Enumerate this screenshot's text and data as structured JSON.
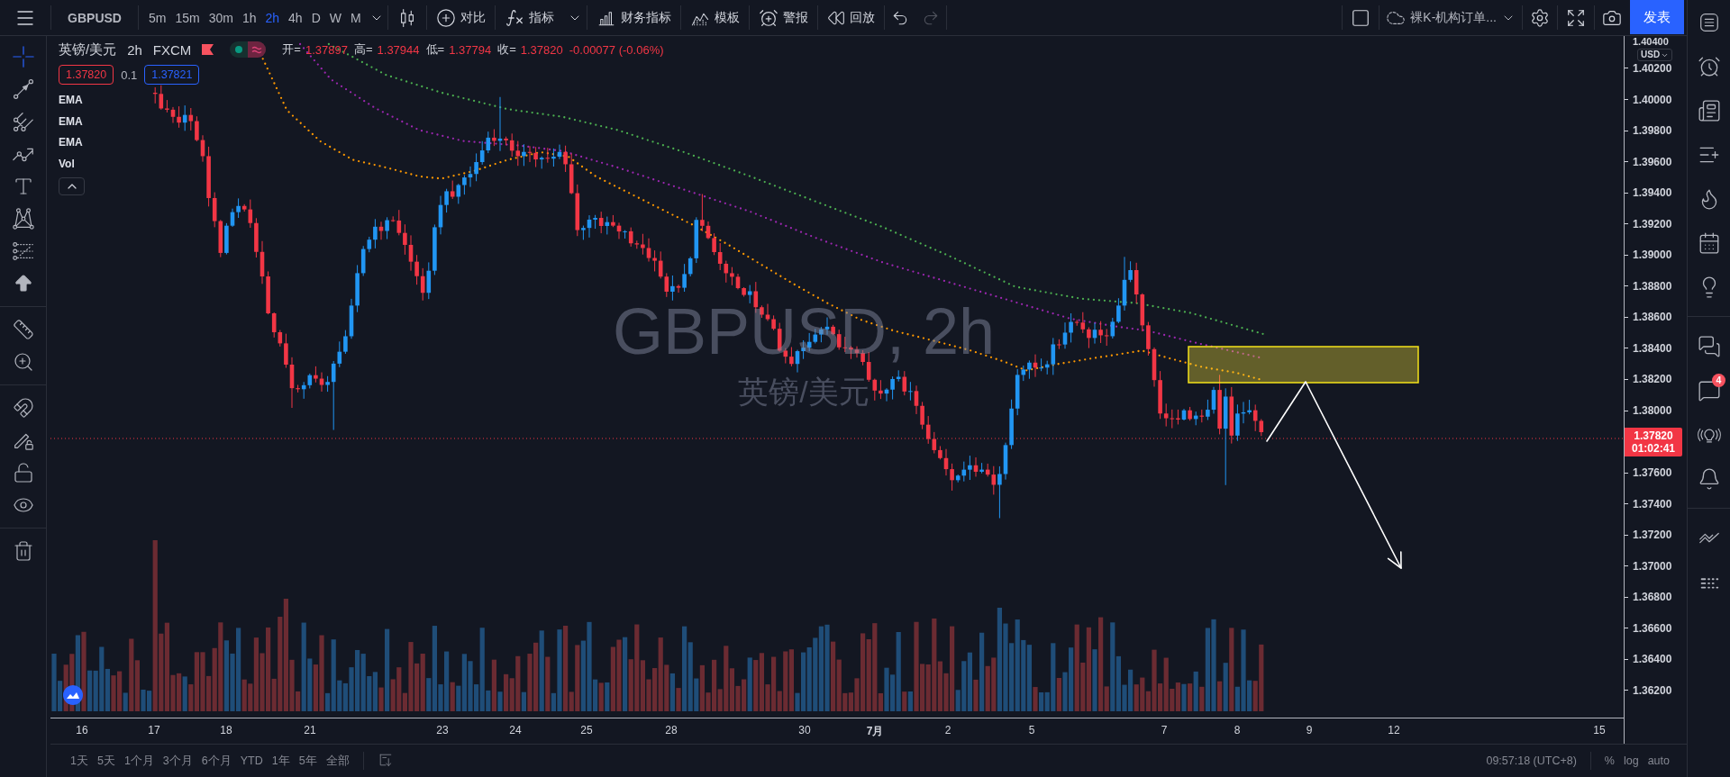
{
  "top_toolbar": {
    "symbol": "GBPUSD",
    "intervals": [
      {
        "label": "5m",
        "selected": false
      },
      {
        "label": "15m",
        "selected": false
      },
      {
        "label": "30m",
        "selected": false
      },
      {
        "label": "1h",
        "selected": false
      },
      {
        "label": "2h",
        "selected": true
      },
      {
        "label": "4h",
        "selected": false
      },
      {
        "label": "D",
        "selected": false
      },
      {
        "label": "W",
        "selected": false
      },
      {
        "label": "M",
        "selected": false
      }
    ],
    "actions": [
      {
        "kind": "compare",
        "label": "对比"
      },
      {
        "kind": "indicators",
        "label": "指标"
      },
      {
        "kind": "financials",
        "label": "财务指标"
      },
      {
        "kind": "templates",
        "label": "模板"
      },
      {
        "kind": "alert",
        "label": "警报"
      },
      {
        "kind": "replay",
        "label": "回放"
      }
    ],
    "undo": {
      "disabled": false
    },
    "redo": {
      "disabled": true
    },
    "layout_name": "裸K-机构订单...",
    "publish": "发表"
  },
  "left_toolbar": {
    "groups": [
      [
        {
          "kind": "crosshair",
          "selected": true
        },
        {
          "kind": "trend-line",
          "selected": false
        },
        {
          "kind": "pitchfork",
          "selected": false
        },
        {
          "kind": "path",
          "selected": false
        },
        {
          "kind": "text",
          "selected": false
        },
        {
          "kind": "pattern",
          "selected": false
        },
        {
          "kind": "fib",
          "selected": false
        },
        {
          "kind": "arrow",
          "selected": false
        }
      ],
      [
        {
          "kind": "ruler",
          "selected": false
        },
        {
          "kind": "zoom",
          "selected": false
        }
      ],
      [
        {
          "kind": "magnet",
          "selected": false
        },
        {
          "kind": "draw-lock",
          "selected": false
        },
        {
          "kind": "lock",
          "selected": false
        },
        {
          "kind": "eye",
          "selected": false
        }
      ],
      [
        {
          "kind": "trash",
          "selected": false
        }
      ]
    ]
  },
  "legend": {
    "name": "英镑/美元",
    "interval": "2h",
    "source": "FXCM",
    "ohlc": [
      {
        "label": "开=",
        "value": "1.37897"
      },
      {
        "label": "高=",
        "value": "1.37944"
      },
      {
        "label": "低=",
        "value": "1.37794"
      },
      {
        "label": "收=",
        "value": "1.37820"
      }
    ],
    "change": "-0.00077 (-0.06%)",
    "sell": "1.37820",
    "spread": "0.1",
    "buy": "1.37821",
    "studies": [
      "EMA",
      "EMA",
      "EMA",
      "Vol"
    ]
  },
  "chart": {
    "watermark_title": "GBPUSD, 2h",
    "watermark_subtitle": "英镑/美元"
  },
  "price_axis": {
    "top_label": "1.40400",
    "currency": "USD",
    "ticks": [
      {
        "kind": "tick",
        "label": "1.40200"
      },
      {
        "kind": "tick",
        "label": "1.40000"
      },
      {
        "kind": "tick",
        "label": "1.39800"
      },
      {
        "kind": "tick",
        "label": "1.39600"
      },
      {
        "kind": "tick",
        "label": "1.39400"
      },
      {
        "kind": "tick",
        "label": "1.39200"
      },
      {
        "kind": "tick",
        "label": "1.39000"
      },
      {
        "kind": "tick",
        "label": "1.38800"
      },
      {
        "kind": "tick",
        "label": "1.38600"
      },
      {
        "kind": "tick",
        "label": "1.38400"
      },
      {
        "kind": "tick",
        "label": "1.38200"
      },
      {
        "kind": "tick",
        "label": "1.38000"
      },
      {
        "kind": "last_price",
        "label": "1.37820",
        "countdown": "01:02:41"
      },
      {
        "kind": "tick",
        "label": "1.37600"
      },
      {
        "kind": "tick",
        "label": "1.37400"
      },
      {
        "kind": "tick",
        "label": "1.37200"
      },
      {
        "kind": "tick",
        "label": "1.37000"
      },
      {
        "kind": "tick",
        "label": "1.36800"
      },
      {
        "kind": "tick",
        "label": "1.36600"
      },
      {
        "kind": "tick",
        "label": "1.36400"
      },
      {
        "kind": "tick",
        "label": "1.36200"
      }
    ]
  },
  "time_axis": {
    "labels": [
      {
        "text": "16",
        "kind": "day"
      },
      {
        "text": "17",
        "kind": "day"
      },
      {
        "text": "18",
        "kind": "day"
      },
      {
        "text": "21",
        "kind": "day"
      },
      {
        "text": "23",
        "kind": "day"
      },
      {
        "text": "24",
        "kind": "day"
      },
      {
        "text": "25",
        "kind": "day"
      },
      {
        "text": "28",
        "kind": "day"
      },
      {
        "text": "30",
        "kind": "day"
      },
      {
        "text": "7月",
        "kind": "month"
      },
      {
        "text": "2",
        "kind": "day"
      },
      {
        "text": "5",
        "kind": "day"
      },
      {
        "text": "7",
        "kind": "day"
      },
      {
        "text": "8",
        "kind": "day"
      },
      {
        "text": "9",
        "kind": "day"
      },
      {
        "text": "12",
        "kind": "day"
      },
      {
        "text": "15",
        "kind": "day"
      }
    ]
  },
  "bottom_bar": {
    "ranges": [
      "1天",
      "5天",
      "1个月",
      "3个月",
      "6个月",
      "YTD",
      "1年",
      "5年",
      "全部"
    ],
    "clock": "09:57:18 (UTC+8)",
    "scale_options": [
      "%",
      "log",
      "auto"
    ]
  },
  "right_sidebar": {
    "groups": [
      [
        {
          "kind": "menu"
        },
        {
          "kind": "alarm"
        },
        {
          "kind": "news"
        },
        {
          "kind": "list-add"
        },
        {
          "kind": "hotlist"
        },
        {
          "kind": "calendar"
        },
        {
          "kind": "ideas"
        }
      ],
      [
        {
          "kind": "chats"
        },
        {
          "kind": "chat",
          "badge": "4"
        },
        {
          "kind": "streams"
        },
        {
          "kind": "notifications"
        }
      ],
      [
        {
          "kind": "patterns"
        },
        {
          "kind": "dots"
        }
      ]
    ]
  }
}
